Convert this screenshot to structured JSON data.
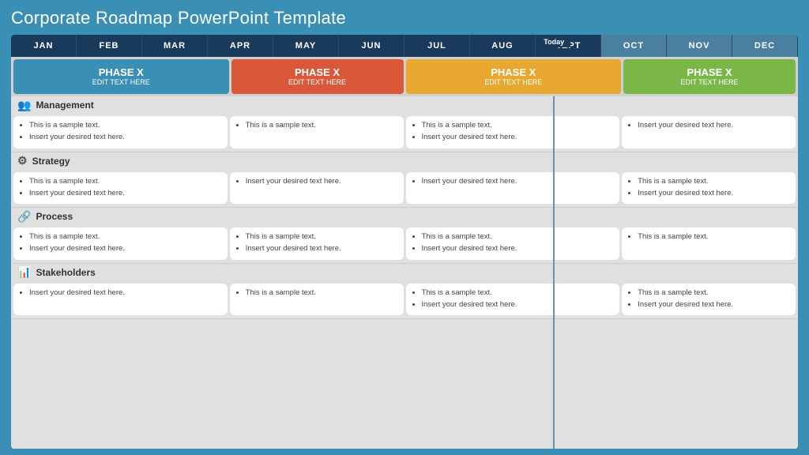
{
  "title": "Corporate Roadmap PowerPoint Template",
  "months": [
    "JAN",
    "FEB",
    "MAR",
    "APR",
    "MAY",
    "JUN",
    "JUL",
    "AUG",
    "SEPT",
    "OCT",
    "NOV",
    "DEC"
  ],
  "months_light": [
    false,
    false,
    false,
    false,
    false,
    false,
    false,
    false,
    false,
    true,
    true,
    true
  ],
  "phases": [
    {
      "label": "PHASE X",
      "sub": "Edit text here",
      "color": "#3a8fb5"
    },
    {
      "label": "PHASE X",
      "sub": "Edit text here",
      "color": "#d9583a"
    },
    {
      "label": "PHASE X",
      "sub": "Edit text here",
      "color": "#e8a830"
    },
    {
      "label": "PHASE X",
      "sub": "Edit text here",
      "color": "#7ab648"
    }
  ],
  "today_label": "Today",
  "sections": [
    {
      "icon": "👥",
      "title": "Management",
      "columns": [
        [
          "This is a sample text.",
          "Insert your desired text here."
        ],
        [
          "This is a sample text."
        ],
        [
          "This is a sample text.",
          "Insert your desired text here."
        ],
        [
          "Insert your desired text here."
        ]
      ]
    },
    {
      "icon": "⚙",
      "title": "Strategy",
      "columns": [
        [
          "This is a sample text.",
          "Insert your desired text here."
        ],
        [
          "Insert your desired text here."
        ],
        [
          "Insert your desired text here."
        ],
        [
          "This is a sample text.",
          "Insert your desired text here."
        ]
      ]
    },
    {
      "icon": "🔗",
      "title": "Process",
      "columns": [
        [
          "This is a sample text.",
          "Insert your desired text here."
        ],
        [
          "This is a sample text.",
          "Insert your desired text here."
        ],
        [
          "This is a sample text.",
          "Insert your desired text here."
        ],
        [
          "This is a sample text."
        ]
      ]
    },
    {
      "icon": "📊",
      "title": "Stakeholders",
      "columns": [
        [
          "Insert your desired text here."
        ],
        [
          "This is a sample text."
        ],
        [
          "This is a sample text.",
          "Insert your desired text here."
        ],
        [
          "This is a sample text.",
          "Insert your desired text here."
        ]
      ]
    }
  ]
}
